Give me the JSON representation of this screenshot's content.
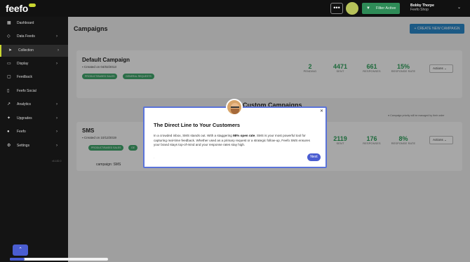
{
  "app": {
    "logo": "feefo"
  },
  "topbar": {
    "menu_icon": "ellipsis-icon",
    "filter_label": "Filter Active",
    "user_name": "Bobby Thorpe",
    "user_org": "Feefo Shop"
  },
  "sidebar": {
    "items": [
      {
        "label": "Dashboard",
        "icon": "grid-icon",
        "has_chevron": false
      },
      {
        "label": "Data Feeds",
        "icon": "tag-icon",
        "has_chevron": true
      },
      {
        "label": "Collection",
        "icon": "send-icon",
        "has_chevron": true,
        "active": true
      },
      {
        "label": "Display",
        "icon": "monitor-icon",
        "has_chevron": true
      },
      {
        "label": "Feedback",
        "icon": "comment-icon",
        "has_chevron": false
      },
      {
        "label": "Feefo Social",
        "icon": "phone-icon",
        "has_chevron": false
      },
      {
        "label": "Analytics",
        "icon": "chart-icon",
        "has_chevron": true
      },
      {
        "label": "Upgrades",
        "icon": "rocket-icon",
        "has_chevron": true
      },
      {
        "label": "Feefo",
        "icon": "feefo-icon",
        "has_chevron": true
      },
      {
        "label": "Settings",
        "icon": "gear-icon",
        "has_chevron": true
      }
    ],
    "version": "v6.182.0"
  },
  "main": {
    "title": "Campaigns",
    "create_button": "CREATE NEW CAMPAIGN",
    "custom_heading": "Custom Campaigns",
    "priority_note": "Campaign priority will be managed by their order",
    "campaigns": [
      {
        "title": "Default Campaign",
        "created": "Created on 04/02/2013",
        "tags": [
          "PRODUCT/BASED SALES",
          "GENERAL REQUESTS"
        ],
        "stats": [
          {
            "value": "2",
            "label": "PENDING"
          },
          {
            "value": "4471",
            "label": "SENT"
          },
          {
            "value": "661",
            "label": "RESPONSES"
          },
          {
            "value": "15%",
            "label": "RESPONSE RATE"
          }
        ],
        "actions": "Actions"
      },
      {
        "title": "SMS",
        "created": "Created on 10/12/2019",
        "tags": [
          "PRODUCT/BASED SALES",
          "GE"
        ],
        "stats": [
          {
            "value": "2119",
            "label": "SENT"
          },
          {
            "value": "176",
            "label": "RESPONSES"
          },
          {
            "value": "8%",
            "label": "RESPONSE RATE"
          }
        ],
        "actions": "Actions",
        "label": "campaign: SMS"
      }
    ]
  },
  "modal": {
    "title": "The Direct Line to Your Customers",
    "text_before": "In a crowded inbox, SMS stands out. With a staggering ",
    "text_bold": "98% open rate",
    "text_after": ", SMS is your most powerful tool for capturing real-time feedback. Whether used as a primary request or a strategic follow-up, Feefo SMS ensures your brand stays top-of-mind and your response rates stay high.",
    "next_label": "Next",
    "close_icon": "close-icon"
  },
  "tour_progress": {
    "value": 0.15
  },
  "colors": {
    "accent": "#4a5dd1",
    "green": "#2e9e5a",
    "brand_yellow": "#c9d630",
    "blue_button": "#2a86c7"
  }
}
